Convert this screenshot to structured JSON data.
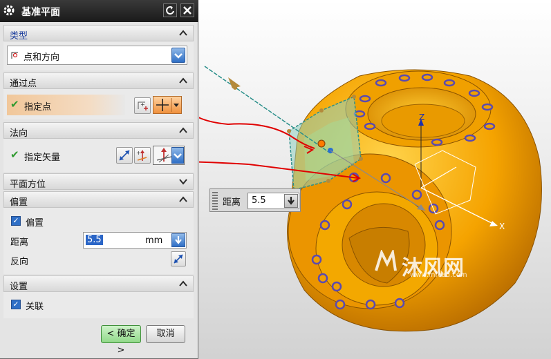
{
  "dialog": {
    "title": "基准平面",
    "sections": {
      "type": {
        "label": "类型",
        "selected": "点和方向"
      },
      "through_point": {
        "label": "通过点",
        "specify": "指定点"
      },
      "normal": {
        "label": "法向",
        "specify": "指定矢量"
      },
      "plane_orientation": {
        "label": "平面方位"
      },
      "offset": {
        "label": "偏置",
        "checkbox": "偏置",
        "distance_label": "距离",
        "distance_value": "5.5",
        "unit": "mm",
        "reverse_label": "反向"
      },
      "settings": {
        "label": "设置",
        "associative": "关联"
      }
    },
    "buttons": {
      "ok": "< 确定 >",
      "cancel": "取消"
    }
  },
  "floating_field": {
    "label": "距离",
    "value": "5.5"
  },
  "viewport": {
    "axes": {
      "x": "X",
      "z": "Z"
    },
    "watermark": {
      "brand": "沐风网",
      "url": "www.mfcad.com"
    }
  },
  "colors": {
    "accent_blue": "#2f6fc6",
    "part_orange": "#f5a300",
    "annotation_red": "#e00000",
    "ok_green": "#a6e3a0"
  }
}
